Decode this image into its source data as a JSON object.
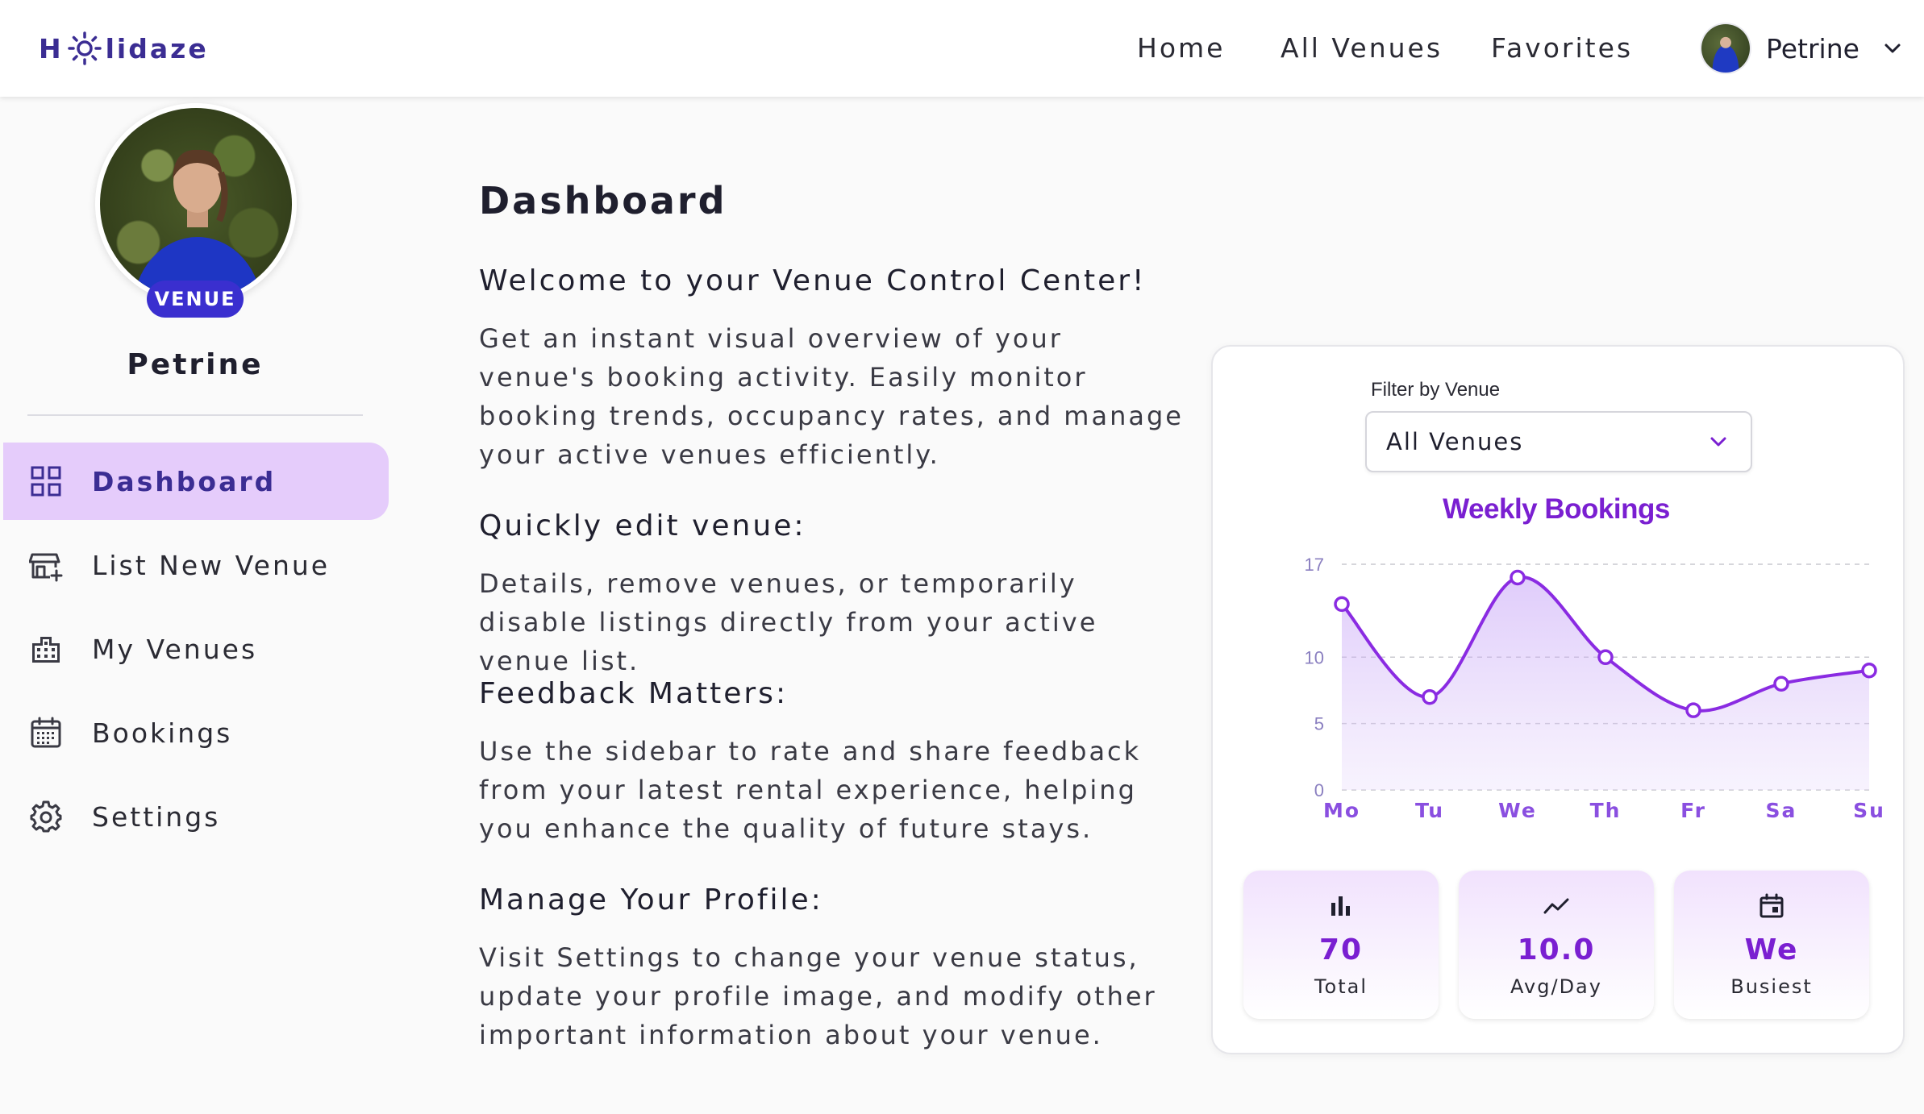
{
  "brand": {
    "logo_left": "H",
    "logo_right": "lidaze"
  },
  "nav": {
    "links": [
      "Home",
      "All Venues",
      "Favorites"
    ],
    "user_name": "Petrine"
  },
  "sidebar": {
    "badge": "VENUE",
    "name": "Petrine",
    "items": [
      {
        "label": "Dashboard",
        "icon": "grid-icon",
        "active": true
      },
      {
        "label": "List New Venue",
        "icon": "store-plus-icon"
      },
      {
        "label": "My Venues",
        "icon": "building-icon"
      },
      {
        "label": "Bookings",
        "icon": "calendar-icon"
      },
      {
        "label": "Settings",
        "icon": "gear-icon"
      }
    ]
  },
  "main": {
    "title": "Dashboard",
    "sections": [
      {
        "heading": "Welcome to your Venue Control Center!",
        "body": "Get an instant visual overview of your venue's booking activity. Easily monitor booking trends, occupancy rates, and manage your active venues efficiently."
      },
      {
        "heading": "Quickly edit venue:",
        "body": "Details, remove venues, or temporarily disable listings directly from your active venue list."
      },
      {
        "heading": "Feedback Matters:",
        "body": "Use the sidebar to rate and share feedback from your latest rental experience, helping you enhance the quality of future stays."
      },
      {
        "heading": "Manage Your Profile:",
        "body": "Visit Settings to change your venue status, update your profile image, and modify other important information about your venue."
      }
    ]
  },
  "card": {
    "filter_label": "Filter by Venue",
    "filter_value": "All Venues",
    "stats": [
      {
        "value": "70",
        "label": "Total",
        "icon": "bar-chart-icon"
      },
      {
        "value": "10.0",
        "label": "Avg/Day",
        "icon": "trend-line-icon"
      },
      {
        "value": "We",
        "label": "Busiest",
        "icon": "calendar-day-icon"
      }
    ]
  },
  "chart_data": {
    "type": "area",
    "title": "Weekly Bookings",
    "categories": [
      "Mo",
      "Tu",
      "We",
      "Th",
      "Fr",
      "Sa",
      "Su"
    ],
    "series": [
      {
        "values": [
          14,
          7,
          16,
          10,
          6,
          8,
          9
        ]
      }
    ],
    "yticks": [
      0,
      5,
      10,
      17
    ],
    "ylim": [
      0,
      17
    ],
    "grid": true,
    "color": "#8a2be2"
  }
}
